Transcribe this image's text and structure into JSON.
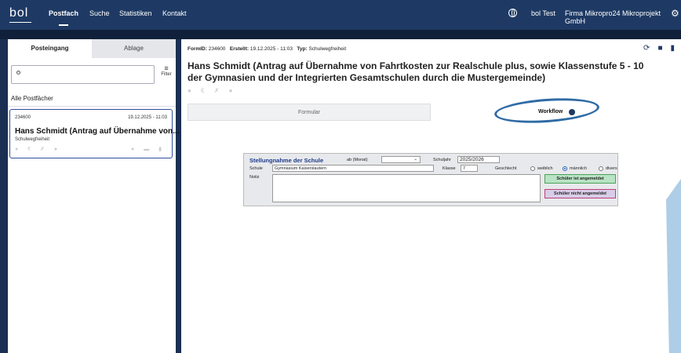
{
  "header": {
    "logo": "bol",
    "nav": [
      "Postfach",
      "Suche",
      "Statistiken",
      "Kontakt"
    ],
    "user": "bol Test",
    "company": "Firma Mikropro24 Mikroprojekt GmbH"
  },
  "left": {
    "tabs": [
      "Posteingang",
      "Ablage"
    ],
    "search_placeholder": "",
    "filter_label": "Filter",
    "all_mailboxes": "Alle Postfächer",
    "card": {
      "id": "234600",
      "date": "19.12.2025 - 11:03",
      "title": "Hans Schmidt (Antrag auf Übernahme von...",
      "subtitle": "Schulwegfreiheit"
    }
  },
  "right": {
    "meta": {
      "formid_label": "FormID:",
      "formid": "234600",
      "created_label": "Erstellt:",
      "created": "19.12.2025 - 11:03",
      "type_label": "Typ:",
      "type": "Schulwegfreiheit"
    },
    "title": "Hans Schmidt (Antrag auf Übernahme von Fahrtkosten zur Realschule plus, sowie Klassenstufe 5 - 10 der Gymnasien und der Integrierten Gesamtschulen durch die Mustergemeinde)",
    "tabs": [
      "Formular",
      "Workflow"
    ]
  },
  "form": {
    "title": "Stellungnahme der Schule",
    "ab_label": "ab (Monat)",
    "ab_value": "",
    "schuljahr_label": "Schuljahr",
    "schuljahr_value": "2025/2026",
    "schule_label": "Schule",
    "schule_value": "Gymnasium Kaiserslautern",
    "klasse_label": "Klasse",
    "klasse_value": "7",
    "geschlecht_label": "Geschlecht",
    "gender_options": [
      "weiblich",
      "männlich",
      "divers"
    ],
    "gender_selected": "männlich",
    "notiz_label": "Notiz",
    "btn_registered": "Schüler ist angemeldet",
    "btn_not_registered": "Schüler nicht angemeldet"
  }
}
